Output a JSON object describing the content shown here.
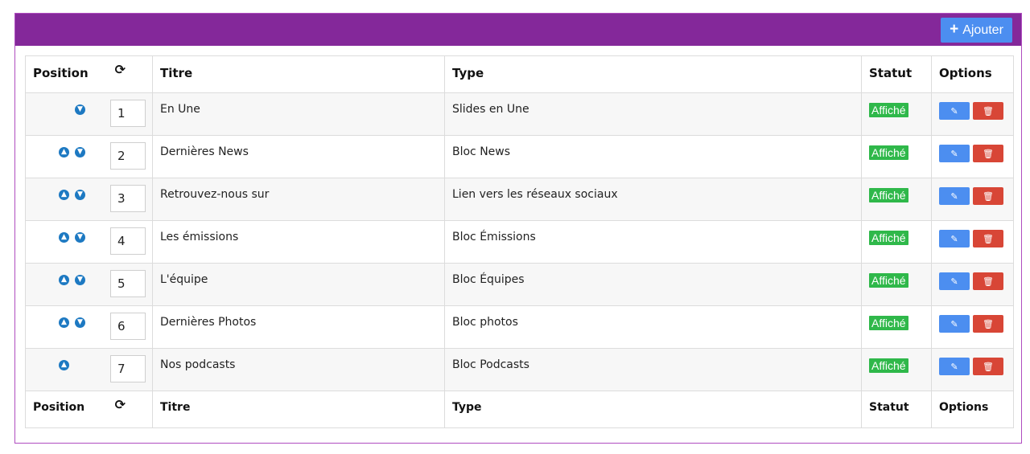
{
  "header": {
    "add_button_label": "Ajouter"
  },
  "table": {
    "columns": {
      "position": "Position",
      "titre": "Titre",
      "type": "Type",
      "statut": "Statut",
      "options": "Options"
    },
    "rows": [
      {
        "position": "1",
        "titre": "En Une",
        "type": "Slides en Une",
        "statut": "Affiché",
        "can_up": false,
        "can_down": true
      },
      {
        "position": "2",
        "titre": "Dernières News",
        "type": "Bloc News",
        "statut": "Affiché",
        "can_up": true,
        "can_down": true
      },
      {
        "position": "3",
        "titre": "Retrouvez-nous sur",
        "type": "Lien vers les réseaux sociaux",
        "statut": "Affiché",
        "can_up": true,
        "can_down": true
      },
      {
        "position": "4",
        "titre": "Les émissions",
        "type": "Bloc Émissions",
        "statut": "Affiché",
        "can_up": true,
        "can_down": true
      },
      {
        "position": "5",
        "titre": "L'équipe",
        "type": "Bloc Équipes",
        "statut": "Affiché",
        "can_up": true,
        "can_down": true
      },
      {
        "position": "6",
        "titre": "Dernières Photos",
        "type": "Bloc photos",
        "statut": "Affiché",
        "can_up": true,
        "can_down": true
      },
      {
        "position": "7",
        "titre": "Nos podcasts",
        "type": "Bloc Podcasts",
        "statut": "Affiché",
        "can_up": true,
        "can_down": false
      }
    ]
  },
  "colors": {
    "header": "#84289a",
    "add_button": "#4c8ef0",
    "status_badge": "#2fb84a",
    "edit_button": "#4c8ef0",
    "delete_button": "#d84636",
    "arrow_icon": "#1d79c2"
  },
  "icons": {
    "add": "plus-icon",
    "reorder": "refresh-icon",
    "up": "arrow-circle-up-icon",
    "down": "arrow-circle-down-icon",
    "edit": "pencil-icon",
    "delete": "trash-icon"
  }
}
